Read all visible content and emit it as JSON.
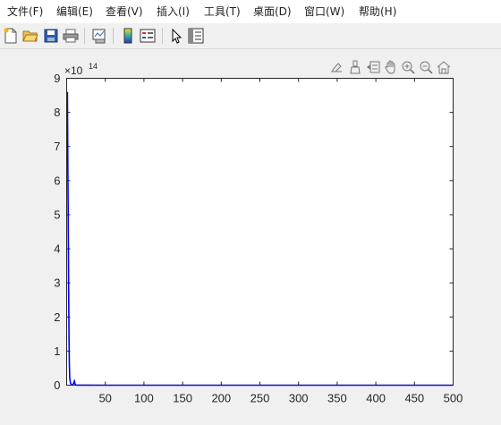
{
  "menubar": {
    "items": [
      {
        "label": "文件(F)"
      },
      {
        "label": "编辑(E)"
      },
      {
        "label": "查看(V)"
      },
      {
        "label": "插入(I)"
      },
      {
        "label": "工具(T)"
      },
      {
        "label": "桌面(D)"
      },
      {
        "label": "窗口(W)"
      },
      {
        "label": "帮助(H)"
      }
    ]
  },
  "toolbar": {
    "icons": [
      "new-file-icon",
      "open-folder-icon",
      "save-icon",
      "print-icon",
      "link-plot-icon",
      "colorbar-icon",
      "legend-icon",
      "edit-plot-icon",
      "property-inspector-icon"
    ]
  },
  "axes_toolbar": {
    "icons": [
      "export-icon",
      "brush-icon",
      "data-tips-icon",
      "pan-icon",
      "zoom-in-icon",
      "zoom-out-icon",
      "restore-view-icon"
    ]
  },
  "chart_data": {
    "type": "line",
    "series": [
      {
        "color": "#0000ff",
        "x": [
          1,
          1.5,
          2,
          2.5,
          3,
          3.5,
          4,
          5,
          6,
          7,
          8,
          9,
          10,
          11,
          12,
          14,
          20,
          50,
          100,
          200,
          300,
          400,
          500
        ],
        "y": [
          860000000000000.0,
          650000000000000.0,
          500000000000000.0,
          300000000000000.0,
          150000000000000.0,
          60000000000000.0,
          20000000000000.0,
          6000000000000.0,
          2000000000000.0,
          1000000000000.0,
          500000000000.0,
          6000000000000.0,
          12000000000000.0,
          3000000000000.0,
          500000000000.0,
          200000000000.0,
          100000000000.0,
          0,
          0,
          0,
          0,
          0,
          0
        ]
      }
    ],
    "xlim": [
      0,
      500
    ],
    "ylim": [
      0,
      900000000000000.0
    ],
    "xticks": [
      "50",
      "100",
      "150",
      "200",
      "250",
      "300",
      "350",
      "400",
      "450",
      "500"
    ],
    "yticks": [
      "0",
      "1",
      "2",
      "3",
      "4",
      "5",
      "6",
      "7",
      "8",
      "9"
    ],
    "exponent_label": "×10",
    "exponent_power": "14",
    "grid": false
  }
}
